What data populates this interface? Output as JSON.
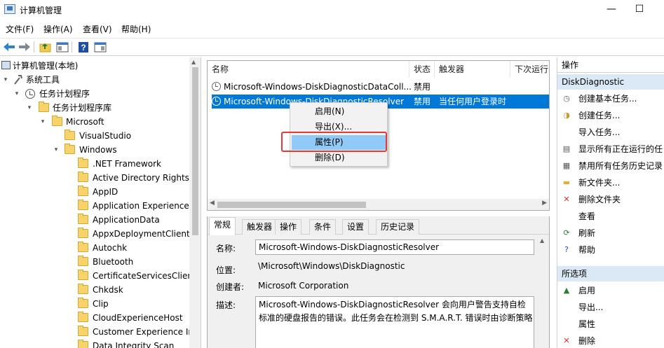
{
  "window": {
    "title": "计算机管理",
    "minimize": "—",
    "maximize": "☐"
  },
  "menu": [
    "文件(F)",
    "操作(A)",
    "查看(V)",
    "帮助(H)"
  ],
  "tree": [
    {
      "label": "计算机管理(本地)",
      "level": 0,
      "arrow": "",
      "icon": "computer"
    },
    {
      "label": "系统工具",
      "level": 1,
      "arrow": "▾",
      "icon": "tools"
    },
    {
      "label": "任务计划程序",
      "level": 2,
      "arrow": "▾",
      "icon": "clock"
    },
    {
      "label": "任务计划程序库",
      "level": 3,
      "arrow": "▾",
      "icon": "folder"
    },
    {
      "label": "Microsoft",
      "level": 4,
      "arrow": "▾",
      "icon": "folder"
    },
    {
      "label": "VisualStudio",
      "level": 5,
      "arrow": "",
      "icon": "folder"
    },
    {
      "label": "Windows",
      "level": 5,
      "arrow": "▾",
      "icon": "folder"
    },
    {
      "label": ".NET Framework",
      "level": 6,
      "arrow": "",
      "icon": "folder"
    },
    {
      "label": "Active Directory Rights",
      "level": 6,
      "arrow": "",
      "icon": "folder"
    },
    {
      "label": "AppID",
      "level": 6,
      "arrow": "",
      "icon": "folder"
    },
    {
      "label": "Application Experience",
      "level": 6,
      "arrow": "",
      "icon": "folder"
    },
    {
      "label": "ApplicationData",
      "level": 6,
      "arrow": "",
      "icon": "folder"
    },
    {
      "label": "AppxDeploymentClient",
      "level": 6,
      "arrow": "",
      "icon": "folder"
    },
    {
      "label": "Autochk",
      "level": 6,
      "arrow": "",
      "icon": "folder"
    },
    {
      "label": "Bluetooth",
      "level": 6,
      "arrow": "",
      "icon": "folder"
    },
    {
      "label": "CertificateServicesClient",
      "level": 6,
      "arrow": "",
      "icon": "folder"
    },
    {
      "label": "Chkdsk",
      "level": 6,
      "arrow": "",
      "icon": "folder"
    },
    {
      "label": "Clip",
      "level": 6,
      "arrow": "",
      "icon": "folder"
    },
    {
      "label": "CloudExperienceHost",
      "level": 6,
      "arrow": "",
      "icon": "folder"
    },
    {
      "label": "Customer Experience Ir",
      "level": 6,
      "arrow": "",
      "icon": "folder"
    },
    {
      "label": "Data Integrity Scan",
      "level": 6,
      "arrow": "",
      "icon": "folder"
    }
  ],
  "list": {
    "columns": [
      "名称",
      "状态",
      "触发器",
      "下次运行"
    ],
    "rows": [
      {
        "name": "Microsoft-Windows-DiskDiagnosticDataColl...",
        "status": "禁用",
        "trigger": "",
        "selected": false
      },
      {
        "name": "Microsoft-Windows-DiskDiagnosticResolver",
        "status": "禁用",
        "trigger": "当任何用户登录时",
        "selected": true
      }
    ]
  },
  "context_menu": [
    "启用(N)",
    "导出(X)...",
    "属性(P)",
    "删除(D)"
  ],
  "detail": {
    "tabs": [
      "常规",
      "触发器",
      "操作",
      "条件",
      "设置",
      "历史记录"
    ],
    "name_label": "名称:",
    "name_value": "Microsoft-Windows-DiskDiagnosticResolver",
    "location_label": "位置:",
    "location_value": "\\Microsoft\\Windows\\DiskDiagnostic",
    "author_label": "创建者:",
    "author_value": "Microsoft Corporation",
    "desc_label": "描述:",
    "desc_line1": "Microsoft-Windows-DiskDiagnosticResolver 会向用户警告支持自检",
    "desc_line2": "标准的硬盘报告的错误。此任务会在检测到 S.M.A.R.T. 错误时由诊断策略"
  },
  "actions": {
    "header": "操作",
    "section1": "DiskDiagnostic",
    "items1": [
      {
        "label": "创建基本任务...",
        "icon": "clock-icon",
        "glyph": "◷",
        "color": "#666666"
      },
      {
        "label": "创建任务...",
        "icon": "task-icon",
        "glyph": "◑",
        "color": "#c99a2e"
      },
      {
        "label": "导入任务...",
        "icon": "",
        "glyph": "",
        "color": ""
      },
      {
        "label": "显示所有正在运行的任",
        "icon": "list-icon",
        "glyph": "▤",
        "color": "#555555"
      },
      {
        "label": "禁用所有任务历史记录",
        "icon": "log-icon",
        "glyph": "▦",
        "color": "#555555"
      },
      {
        "label": "新文件夹...",
        "icon": "folder-icon",
        "glyph": "▬",
        "color": "#e0b03a"
      },
      {
        "label": "删除文件夹",
        "icon": "delete-icon",
        "glyph": "✕",
        "color": "#d32f2f"
      },
      {
        "label": "查看",
        "icon": "",
        "glyph": "",
        "color": ""
      },
      {
        "label": "刷新",
        "icon": "refresh-icon",
        "glyph": "⟳",
        "color": "#2e7d32"
      },
      {
        "label": "帮助",
        "icon": "help-icon",
        "glyph": "?",
        "color": "#1f4e9e"
      }
    ],
    "section2": "所选项",
    "items2": [
      {
        "label": "启用",
        "icon": "enable-icon",
        "glyph": "▲",
        "color": "#2e7d32"
      },
      {
        "label": "导出...",
        "icon": "",
        "glyph": "",
        "color": ""
      },
      {
        "label": "属性",
        "icon": "",
        "glyph": "",
        "color": ""
      },
      {
        "label": "删除",
        "icon": "delete-icon",
        "glyph": "✕",
        "color": "#d32f2f"
      }
    ]
  }
}
